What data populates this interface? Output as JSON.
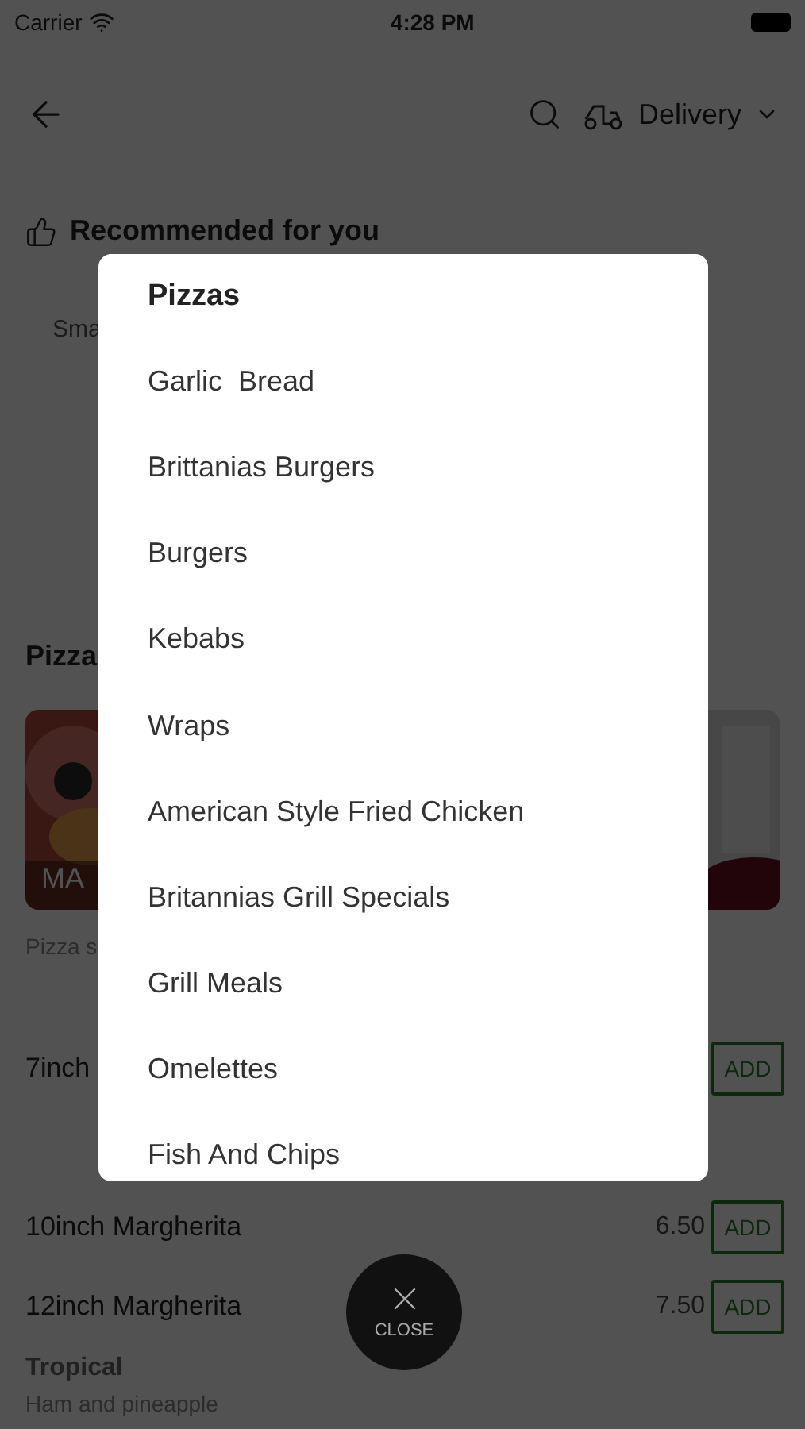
{
  "status_bar": {
    "carrier": "Carrier",
    "time": "4:28 PM"
  },
  "header": {
    "mode": "Delivery"
  },
  "recommended": {
    "title": "Recommended for you",
    "item": "Sma"
  },
  "section": {
    "title": "Pizza",
    "card_label": "MA",
    "description": "Pizza s"
  },
  "rows": [
    {
      "name": "7inch",
      "price": "",
      "button": "ADD"
    },
    {
      "name": "10inch Margherita",
      "price": "6.50",
      "button": "ADD"
    },
    {
      "name": "12inch Margherita",
      "price": "7.50",
      "button": "ADD"
    }
  ],
  "next_item": {
    "name": "Tropical",
    "description": "Ham and pineapple"
  },
  "menu": {
    "title": "Pizzas",
    "items": [
      "Garlic  Bread",
      "Brittanias Burgers",
      "Burgers",
      "Kebabs",
      "Wraps",
      "American Style Fried Chicken",
      "Britannias Grill Specials",
      "Grill Meals",
      "Omelettes",
      "Fish And Chips"
    ]
  },
  "close_button": {
    "label": "CLOSE"
  }
}
